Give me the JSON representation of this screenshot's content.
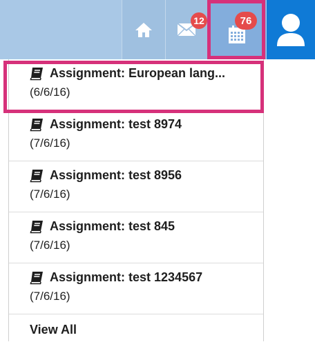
{
  "topbar": {
    "mail_count": "12",
    "calendar_count": "76"
  },
  "icons": [
    "home-icon",
    "mail-icon",
    "calendar-icon",
    "user-icon",
    "book-icon"
  ],
  "colors": {
    "topbar": "#a9c8e6",
    "calendar_active": "#83addc",
    "user_button": "#0f7ad6",
    "badge": "#e54b4b",
    "highlight": "#d6317a"
  },
  "dropdown": {
    "items": [
      {
        "title": "Assignment: European lang...",
        "date": "(6/6/16)"
      },
      {
        "title": "Assignment: test 8974",
        "date": "(7/6/16)"
      },
      {
        "title": "Assignment: test 8956",
        "date": "(7/6/16)"
      },
      {
        "title": "Assignment: test 845",
        "date": "(7/6/16)"
      },
      {
        "title": "Assignment: test 1234567",
        "date": "(7/6/16)"
      }
    ],
    "view_all": "View All"
  }
}
